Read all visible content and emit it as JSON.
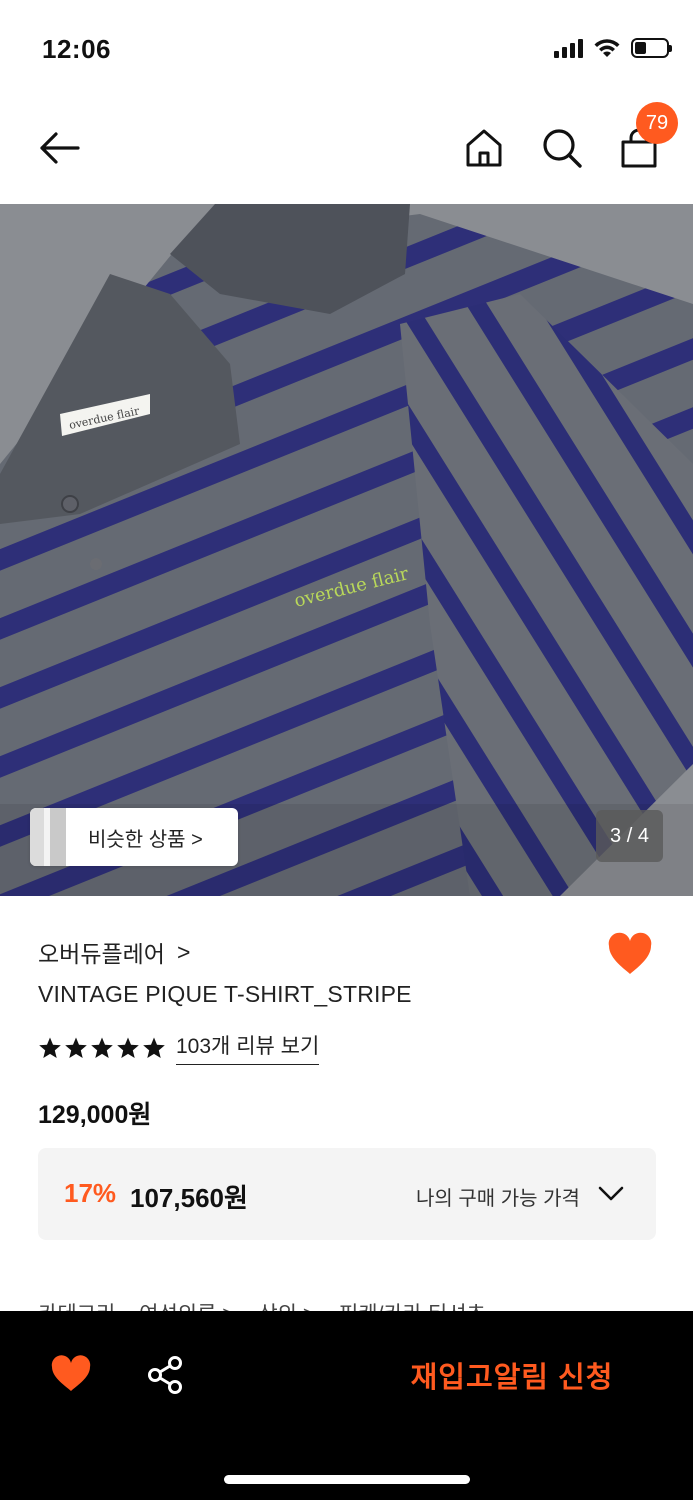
{
  "status_bar": {
    "time": "12:06",
    "battery_level": 0.35
  },
  "nav": {
    "back_icon": "arrow-left-icon",
    "home_icon": "home-icon",
    "search_icon": "search-icon",
    "cart_icon": "shopping-bag-icon",
    "cart_badge": "79"
  },
  "gallery": {
    "similar_button_label": "비슷한 상품 >",
    "page_counter": "3 / 4",
    "shirt_label_text": "overdue flair",
    "embroidery_text": "overdue flair"
  },
  "product": {
    "brand": "오버듀플레어",
    "brand_chevron": ">",
    "name": "VINTAGE PIQUE T-SHIRT_STRIPE",
    "rating_stars": 5,
    "review_link": "103개 리뷰 보기",
    "original_price": "129,000원",
    "discount_rate": "17%",
    "sale_price": "107,560원",
    "my_price_label": "나의 구매 가능 가격",
    "category_label": "카테고리",
    "category_path": [
      "여성의류 >",
      "상의 >",
      "피케/카라 티셔츠"
    ]
  },
  "bottom_bar": {
    "restock_button": "재입고알림 신청",
    "share_icon": "share-icon",
    "heart_icon": "heart-icon"
  },
  "colors": {
    "accent": "#ff5a1f",
    "bottom_bar": "#000000",
    "price_box": "#f4f4f4"
  }
}
